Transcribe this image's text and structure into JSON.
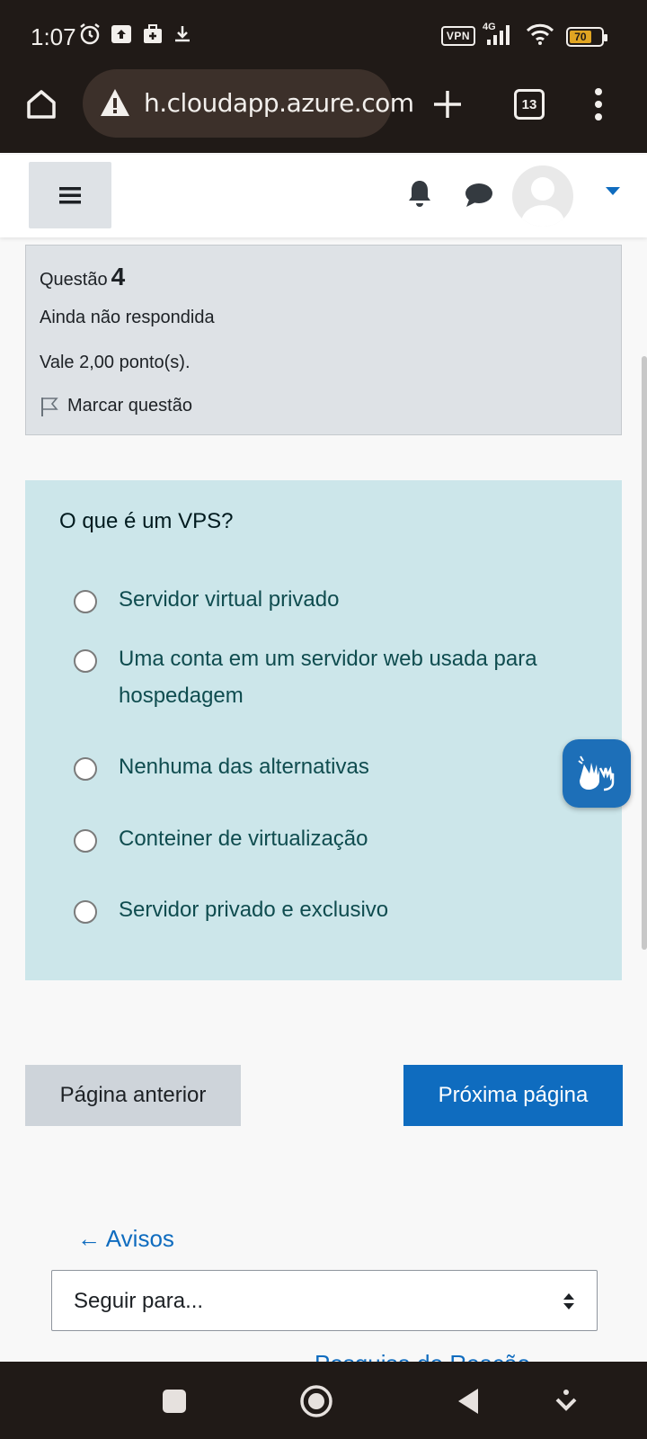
{
  "status_bar": {
    "time": "1:07",
    "vpn": "VPN",
    "network": "4G",
    "battery": "70",
    "battery_level": 0.7
  },
  "browser": {
    "url": "h.cloudapp.azure.com",
    "tab_count": "13"
  },
  "question": {
    "label": "Questão",
    "number": "4",
    "state": "Ainda não respondida",
    "grade": "Vale 2,00 ponto(s).",
    "flag_label": "Marcar questão",
    "text": "O que é um VPS?",
    "options": [
      "Servidor virtual privado",
      "Uma conta em um servidor web usada para hospedagem",
      "Nenhuma das alternativas",
      "Conteiner de virtualização",
      "Servidor privado e exclusivo"
    ]
  },
  "navigation": {
    "prev_label": "Página anterior",
    "next_label": "Próxima página",
    "prev_activity": "← Avisos",
    "jump_placeholder": "Seguir para...",
    "next_activity": "Pesquisa de Reação"
  },
  "colors": {
    "accent": "#0f6cbf",
    "question_bg": "#cce6ea",
    "info_bg": "#dee2e6"
  }
}
